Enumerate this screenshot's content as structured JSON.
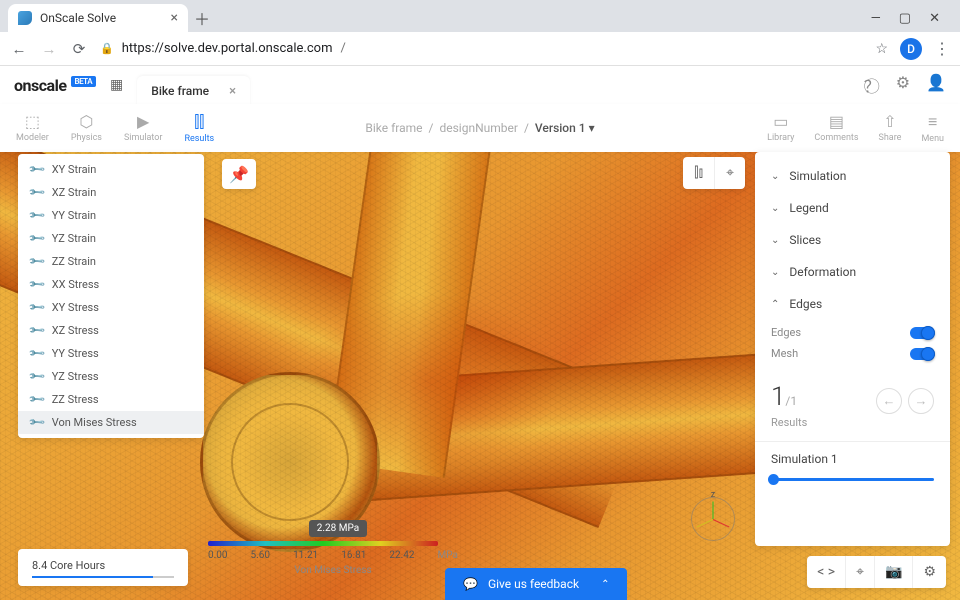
{
  "browser": {
    "tab_title": "OnScale Solve",
    "url_host": "https://solve.dev.portal.onscale.com",
    "url_path": "/",
    "avatar_initial": "D"
  },
  "app": {
    "logo": "onscale",
    "beta": "BETA",
    "file_tab": "Bike frame"
  },
  "toolbar": {
    "modeler": "Modeler",
    "physics": "Physics",
    "simulator": "Simulator",
    "results": "Results",
    "library": "Library",
    "comments": "Comments",
    "share": "Share",
    "menu": "Menu"
  },
  "breadcrumb": {
    "a": "Bike frame",
    "b": "designNumber",
    "c": "Version 1"
  },
  "result_list": [
    "XY Strain",
    "XZ Strain",
    "YY Strain",
    "YZ Strain",
    "ZZ Strain",
    "XX Stress",
    "XY Stress",
    "XZ Stress",
    "YY Stress",
    "YZ Stress",
    "ZZ Stress",
    "Von Mises Stress"
  ],
  "right_panel": {
    "simulation": "Simulation",
    "legend": "Legend",
    "slices": "Slices",
    "deformation": "Deformation",
    "edges": "Edges",
    "edges_toggle": "Edges",
    "mesh_toggle": "Mesh",
    "counter_current": "1",
    "counter_total": "/1",
    "results_label": "Results",
    "sim_select": "Simulation 1"
  },
  "legend": {
    "tooltip": "2.28 MPa",
    "ticks": [
      "0.00",
      "5.60",
      "11.21",
      "16.81",
      "22.42"
    ],
    "unit": "MPa",
    "label": "Von Mises Stress"
  },
  "core_hours": "8.4 Core Hours",
  "feedback": "Give us feedback",
  "gizmo_label": "z"
}
